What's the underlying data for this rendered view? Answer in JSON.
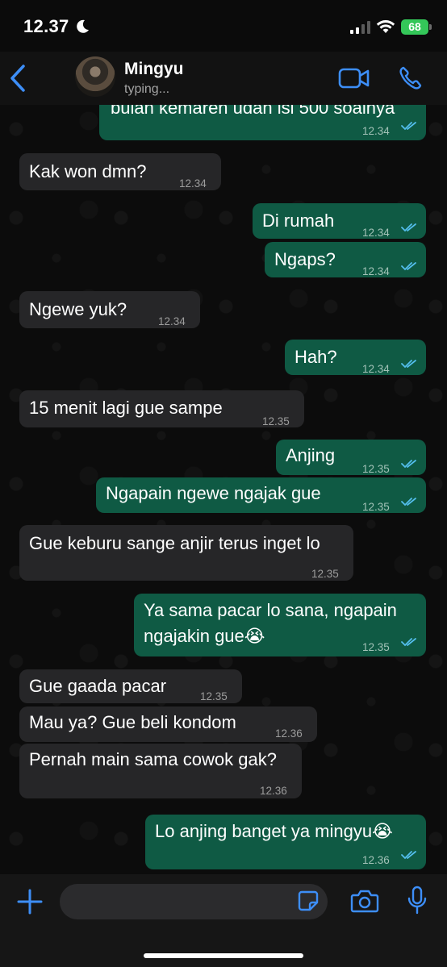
{
  "status_bar": {
    "time": "12.37",
    "battery": "68"
  },
  "header": {
    "contact_name": "Mingyu",
    "contact_status": "typing..."
  },
  "messages": [
    {
      "dir": "out",
      "text": "bulan kemaren udah isi 500 soalnya",
      "time": "12.34",
      "read": true
    },
    {
      "dir": "in",
      "text": "Kak won dmn?",
      "time": "12.34"
    },
    {
      "dir": "out",
      "text": "Di rumah",
      "time": "12.34",
      "read": true
    },
    {
      "dir": "out",
      "text": "Ngaps?",
      "time": "12.34",
      "read": true
    },
    {
      "dir": "in",
      "text": "Ngewe yuk?",
      "time": "12.34"
    },
    {
      "dir": "out",
      "text": "Hah?",
      "time": "12.34",
      "read": true
    },
    {
      "dir": "in",
      "text": "15 menit lagi gue sampe",
      "time": "12.35"
    },
    {
      "dir": "out",
      "text": "Anjing",
      "time": "12.35",
      "read": true
    },
    {
      "dir": "out",
      "text": "Ngapain ngewe ngajak gue",
      "time": "12.35",
      "read": true
    },
    {
      "dir": "in",
      "text": "Gue keburu sange anjir terus inget lo",
      "time": "12.35"
    },
    {
      "dir": "out",
      "text_line1": "Ya sama pacar lo sana, ngapain",
      "text_line2": "ngajakin gue😭",
      "time": "12.35",
      "read": true
    },
    {
      "dir": "in",
      "text": "Gue gaada pacar",
      "time": "12.35"
    },
    {
      "dir": "in",
      "text": "Mau ya? Gue beli kondom",
      "time": "12.36"
    },
    {
      "dir": "in",
      "text": "Pernah main sama cowok gak?",
      "time": "12.36"
    },
    {
      "dir": "out",
      "text": "Lo anjing banget ya mingyu😭",
      "time": "12.36",
      "read": true
    }
  ],
  "icons": {
    "back": "chevron-left-icon",
    "video": "video-call-icon",
    "call": "phone-icon",
    "attach": "plus-icon",
    "sticker": "sticker-icon",
    "camera": "camera-icon",
    "mic": "microphone-icon",
    "read_receipt": "double-check-icon"
  },
  "colors": {
    "accent": "#3d8ef7",
    "outgoing_bubble": "#0f5a44",
    "incoming_bubble": "#262628",
    "read_tick": "#53bdeb"
  }
}
